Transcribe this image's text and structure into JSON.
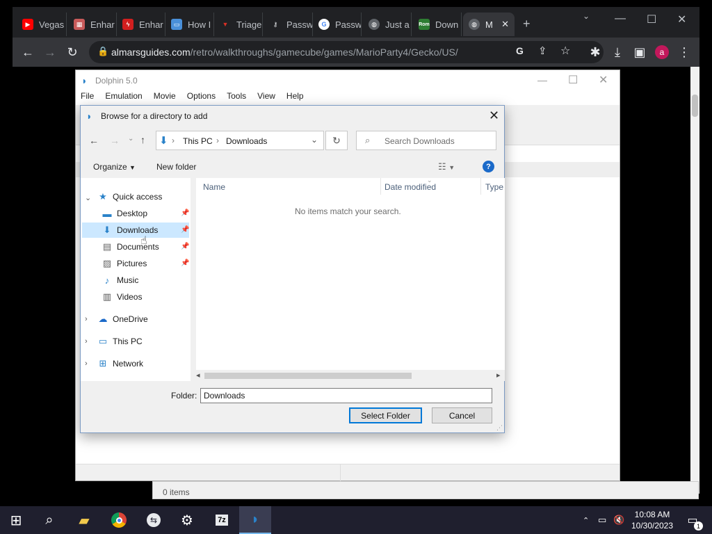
{
  "browser": {
    "tabs": [
      {
        "label": "Vegas",
        "icon": "youtube-icon",
        "color": "#ff0000"
      },
      {
        "label": "Enhar",
        "icon": "site-icon",
        "color": "#c85a5a"
      },
      {
        "label": "Enhar",
        "icon": "lightning-icon",
        "color": "#d21f1f"
      },
      {
        "label": "How I",
        "icon": "monitor-icon",
        "color": "#4a90d9"
      },
      {
        "label": "Triage",
        "icon": "triage-icon",
        "color": "#d93025"
      },
      {
        "label": "Passw",
        "icon": "key-icon",
        "color": "#e8eaed"
      },
      {
        "label": "Passw",
        "icon": "google-icon",
        "color": "#4285f4"
      },
      {
        "label": "Just a",
        "icon": "globe-icon",
        "color": "#9aa0a6"
      },
      {
        "label": "Down",
        "icon": "roms-icon",
        "color": "#2e7d32"
      },
      {
        "label": "M",
        "icon": "globe-icon",
        "color": "#9aa0a6"
      }
    ],
    "new_tab": "+",
    "url_host": "almarsguides.com",
    "url_path": "/retro/walkthroughs/gamecube/games/MarioParty4/Gecko/US/",
    "profile_initial": "a"
  },
  "dolphin": {
    "title": "Dolphin 5.0",
    "menu": [
      "File",
      "Emulation",
      "Movie",
      "Options",
      "Tools",
      "View",
      "Help"
    ],
    "status": "0 items"
  },
  "dialog": {
    "title": "Browse for a directory to add",
    "breadcrumb": [
      "This PC",
      "Downloads"
    ],
    "search_placeholder": "Search Downloads",
    "organize": "Organize",
    "new_folder": "New folder",
    "nav_items": {
      "quick_access": "Quick access",
      "desktop": "Desktop",
      "downloads": "Downloads",
      "documents": "Documents",
      "pictures": "Pictures",
      "music": "Music",
      "videos": "Videos",
      "onedrive": "OneDrive",
      "this_pc": "This PC",
      "network": "Network"
    },
    "columns": {
      "name": "Name",
      "date_modified": "Date modified",
      "type": "Type"
    },
    "empty_message": "No items match your search.",
    "folder_label": "Folder:",
    "folder_value": "Downloads",
    "select_folder": "Select Folder",
    "cancel": "Cancel"
  },
  "taskbar": {
    "time": "10:08 AM",
    "date": "10/30/2023",
    "notification_count": "1"
  }
}
